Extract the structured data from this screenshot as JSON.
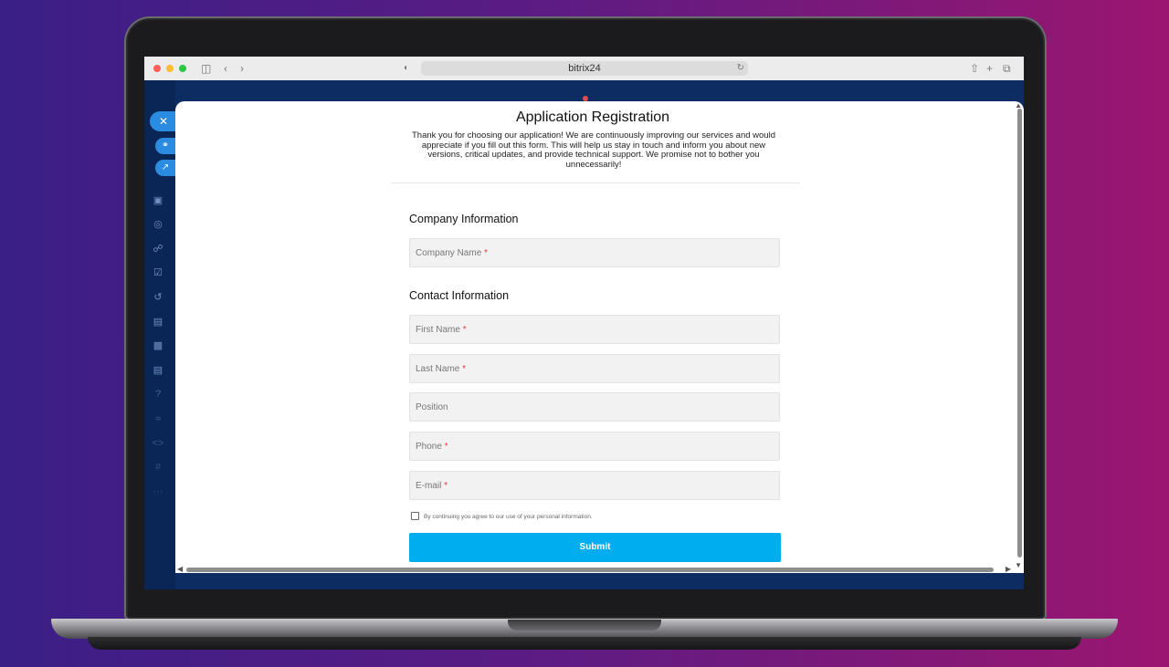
{
  "browser": {
    "url": "bitrix24",
    "icons": {
      "sidebar": "sidebar-toggle-icon",
      "back": "chevron-left-icon",
      "forward": "chevron-right-icon",
      "privacy": "shield-icon",
      "reload": "reload-icon",
      "share": "share-icon",
      "new_tab": "plus-icon",
      "tabs": "tabs-overview-icon"
    }
  },
  "form": {
    "title": "Application Registration",
    "description": "Thank you for choosing our application! We are continuously improving our services and would appreciate if you fill out this form. This will help us stay in touch and inform you about new versions, critical updates, and provide technical support. We promise not to bother you unnecessarily!",
    "company_section": "Company Information",
    "contact_section": "Contact Information",
    "fields": {
      "company_name": "Company Name",
      "first_name": "First Name",
      "last_name": "Last Name",
      "position": "Position",
      "phone": "Phone",
      "email": "E-mail"
    },
    "required_mark": "*",
    "consent": "By continuing you agree to our use of your personal information.",
    "submit": "Submit"
  },
  "colors": {
    "accent": "#00aeef",
    "required": "#e03b3b",
    "app_bg": "#0d2d62"
  }
}
